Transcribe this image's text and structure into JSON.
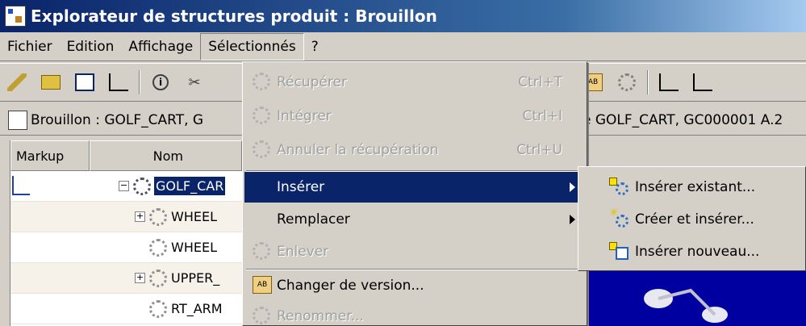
{
  "window": {
    "title": "Explorateur de structures produit : Brouillon"
  },
  "menubar": {
    "items": [
      "Fichier",
      "Edition",
      "Affichage",
      "Sélectionnés",
      "?"
    ]
  },
  "toolbar": {
    "icons": [
      "pencil-icon",
      "folder-icon",
      "window-icon",
      "tree-icon",
      "info-icon",
      "scissors-icon",
      "gear-icon",
      "version-icon"
    ]
  },
  "docbar": {
    "left": "Brouillon : GOLF_CART, G",
    "right": "e GOLF_CART, GC000001 A.2"
  },
  "grid": {
    "headers": {
      "markup": "Markup",
      "nom": "Nom"
    },
    "rows": [
      {
        "label": "GOLF_CAR"
      },
      {
        "label": "WHEEL"
      },
      {
        "label": "WHEEL"
      },
      {
        "label": "UPPER_"
      },
      {
        "label": "RT_ARM"
      }
    ]
  },
  "menu": {
    "recuperer": {
      "label": "Récupérer",
      "shortcut": "Ctrl+T"
    },
    "integrer": {
      "label": "Intégrer",
      "shortcut": "Ctrl+I"
    },
    "annuler": {
      "label": "Annuler la récupération",
      "shortcut": "Ctrl+U"
    },
    "inserer": {
      "label": "Insérer"
    },
    "remplacer": {
      "label": "Remplacer"
    },
    "enlever": {
      "label": "Enlever"
    },
    "changer": {
      "label": "Changer de version..."
    },
    "renommer": {
      "label": "Renommer..."
    }
  },
  "submenu": {
    "existant": "Insérer existant...",
    "creer": "Créer et insérer...",
    "nouveau": "Insérer nouveau..."
  },
  "colors": {
    "title_bar": "#0a246a",
    "highlight": "#0a246a",
    "viewer": "#0000a0"
  }
}
